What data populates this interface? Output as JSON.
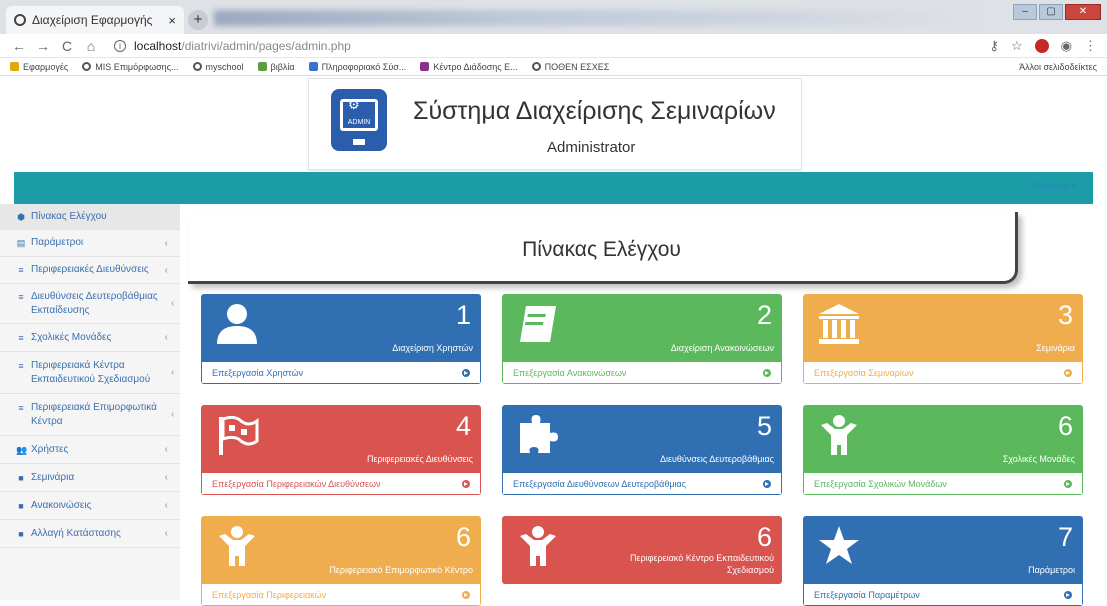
{
  "browser": {
    "tab_title": "Διαχείριση Εφαρμογής",
    "tab_close": "×",
    "new_tab": "+",
    "url_host": "localhost",
    "url_path": "/diatrivi/admin/pages/admin.php",
    "back": "←",
    "forward": "→",
    "reload": "C",
    "home": "⌂",
    "star": "☆",
    "menu": "⋮",
    "window_min": "–",
    "window_max": "▢",
    "window_close": "✕",
    "bookmarks": [
      {
        "label": "Εφαρμογές",
        "color": "#e0a800"
      },
      {
        "label": "MIS Επιμόρφωσης...",
        "color": "#555555"
      },
      {
        "label": "myschool",
        "color": "#555555"
      },
      {
        "label": "βιβλία",
        "color": "#5c9d3f"
      },
      {
        "label": "Πληροφοριακό Σύσ...",
        "color": "#3b6fd0"
      },
      {
        "label": "Κέντρο Διάδοσης Ε...",
        "color": "#8b2f8b"
      },
      {
        "label": "ΠΟΘΕΝ ΕΣΧΕΣ",
        "color": "#555555"
      }
    ],
    "other_bookmarks": "Άλλοι σελιδοδείκτες"
  },
  "header": {
    "title": "Σύστημα Διαχείρισης Σεμιναρίων",
    "subtitle": "Administrator",
    "logo_text": "ADMIN",
    "user_menu": "⚙ Admin ▾"
  },
  "sidebar": {
    "items": [
      {
        "icon": "⬢",
        "label": "Πίνακας Ελέγχου",
        "chevron": ""
      },
      {
        "icon": "▤",
        "label": "Παράμετροι",
        "chevron": "‹"
      },
      {
        "icon": "≡",
        "label": "Περιφερειακές Διευθύνσεις",
        "chevron": "‹"
      },
      {
        "icon": "≡",
        "label": "Διευθύνσεις Δευτεροβάθμιας Εκπαίδευσης",
        "chevron": "‹"
      },
      {
        "icon": "≡",
        "label": "Σχολικές Μονάδες",
        "chevron": "‹"
      },
      {
        "icon": "≡",
        "label": "Περιφερειακά Κέντρα Εκπαιδευτικού Σχεδιασμού",
        "chevron": "‹"
      },
      {
        "icon": "≡",
        "label": "Περιφερειακά Επιμορφωτικά Κέντρα",
        "chevron": "‹"
      },
      {
        "icon": "👥",
        "label": "Χρήστες",
        "chevron": "‹"
      },
      {
        "icon": "■",
        "label": "Σεμινάρια",
        "chevron": "‹"
      },
      {
        "icon": "■",
        "label": "Ανακοινώσεις",
        "chevron": "‹"
      },
      {
        "icon": "■",
        "label": "Αλλαγή Κατάστασης",
        "chevron": "‹"
      }
    ]
  },
  "main": {
    "title": "Πίνακας Ελέγχου",
    "tiles": [
      {
        "number": "1",
        "caption": "Διαχείριση Χρηστών",
        "link": "Επεξεργασία Χρηστών",
        "color": "blue",
        "icon": "user-icon"
      },
      {
        "number": "2",
        "caption": "Διαχείριση Ανακοινώσεων",
        "link": "Επεξεργασία Ανακοινώσεων",
        "color": "green",
        "icon": "book-icon"
      },
      {
        "number": "3",
        "caption": "Σεμινάρια",
        "link": "Επεξεργασία Σεμιναρίων",
        "color": "orange",
        "icon": "institution-icon"
      },
      {
        "number": "4",
        "caption": "Περιφερειακές Διευθύνσεις",
        "link": "Επεξεργασία Περιφερειακών Διευθύνσεων",
        "color": "red",
        "icon": "flag-icon"
      },
      {
        "number": "5",
        "caption": "Διευθύνσεις Δευτεροβάθμιας",
        "link": "Επεξεργασία Διευθύνσεων Δευτεροβάθμιας",
        "color": "blue",
        "icon": "puzzle-icon"
      },
      {
        "number": "6",
        "caption": "Σχολικές Μονάδες",
        "link": "Επεξεργασία Σχολικών Μονάδων",
        "color": "green",
        "icon": "child-icon"
      },
      {
        "number": "6",
        "caption": "Περιφερειακό Επιμορφωτικό Κέντρο",
        "link": "Επεξεργασία Περιφερειακών",
        "color": "orange",
        "icon": "child-icon"
      },
      {
        "number": "6",
        "caption": "Περιφερειακό Κέντρο Εκπαιδευτικού Σχεδιασμού",
        "link": "",
        "color": "red",
        "icon": "child-icon"
      },
      {
        "number": "7",
        "caption": "Παράμετροι",
        "link": "Επεξεργασία Παραμέτρων",
        "color": "blue",
        "icon": "star-icon"
      }
    ]
  }
}
